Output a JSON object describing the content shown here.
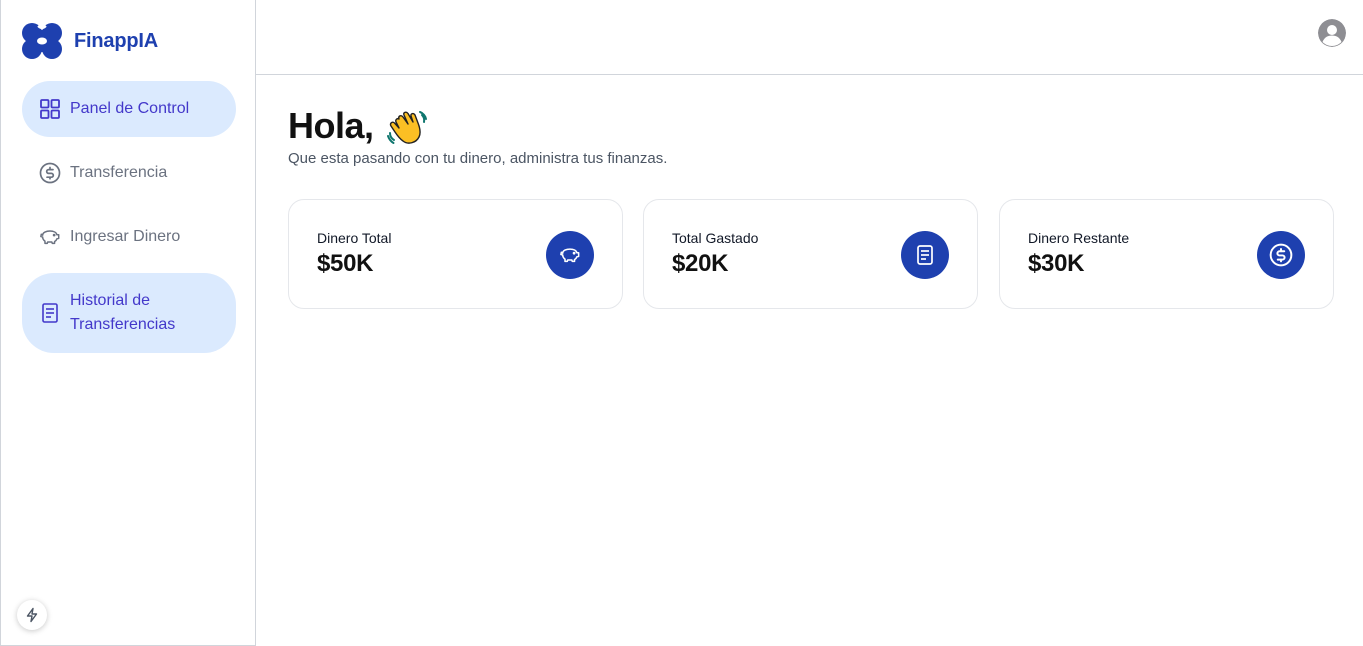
{
  "brand": {
    "name": "FinappIA",
    "logo_icon": "cloud-logo-icon",
    "color": "#1e40af"
  },
  "sidebar": {
    "items": [
      {
        "label": "Panel de Control",
        "icon": "grid-icon",
        "active": true
      },
      {
        "label": "Transferencia",
        "icon": "dollar-circle-icon",
        "active": false
      },
      {
        "label": "Ingresar Dinero",
        "icon": "piggy-bank-icon",
        "active": false
      },
      {
        "label": "Historial de Transferencias",
        "icon": "receipt-icon",
        "active": true
      }
    ],
    "active_bg": "#dbeafe",
    "active_text": "#4338ca",
    "inactive_text": "#6b7280"
  },
  "header": {
    "avatar_icon": "user-avatar-icon"
  },
  "main": {
    "greeting": "Hola,",
    "greeting_emoji": "waving-hand",
    "subtitle": "Que esta pasando con tu dinero, administra tus finanzas."
  },
  "cards": [
    {
      "label": "Dinero Total",
      "value": "$50K",
      "icon": "piggy-bank-icon"
    },
    {
      "label": "Total Gastado",
      "value": "$20K",
      "icon": "receipt-icon"
    },
    {
      "label": "Dinero Restante",
      "value": "$30K",
      "icon": "dollar-circle-icon"
    }
  ],
  "accent": "#1e40af",
  "floating": {
    "icon": "bolt-icon"
  }
}
